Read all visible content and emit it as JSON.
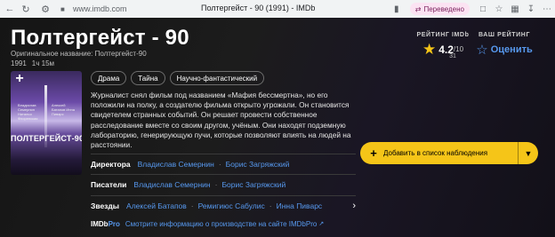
{
  "browser": {
    "url": "www.imdb.com",
    "tab_title": "Полтергейст - 90 (1991) - IMDb",
    "translated_label": "Переведено"
  },
  "movie": {
    "title": "Полтергейст - 90",
    "original_title": "Оригинальное название: Полтергейст-90",
    "year": "1991",
    "runtime": "1ч 15м",
    "genres": [
      "Драма",
      "Тайна",
      "Научно-фантастический"
    ],
    "plot": "Журналист снял фильм под названием «Мафия бессмертна», но его положили на полку, а создателю фильма открыто угрожали. Он становится свидетелем странных событий. Он решает провести собственное расследование вместе со своим другом, учёным. Они находят подземную лабораторию, генерирующую пучи, которые позволяют влиять на людей на расстоянии.",
    "poster_title": "ПОЛТЕРГЕЙСТ-90",
    "poster_names_left": "Владислав Семернин Наталья Флоренская",
    "poster_names_right": "Алексей Батапов Инна Пиварс"
  },
  "rating": {
    "label": "РЕЙТИНГ IMDb",
    "score": "4.2",
    "out_of": "/10",
    "votes": "31"
  },
  "your_rating": {
    "label": "ВАШ РЕЙТИНГ",
    "action": "Оценить"
  },
  "credits": {
    "directors_label": "Директора",
    "directors": [
      "Владислав Семернин",
      "Борис Загряжский"
    ],
    "writers_label": "Писатели",
    "writers": [
      "Владислав Семернин",
      "Борис Загряжский"
    ],
    "stars_label": "Звезды",
    "stars": [
      "Алексей Батапов",
      "Ремигиюс Сабулис",
      "Инна Пиварс"
    ]
  },
  "imdbpro": {
    "logo_main": "IMDb",
    "logo_pro": "Pro",
    "link": "Смотрите информацию о производстве на сайте IMDbPro"
  },
  "watchlist": {
    "label": "Добавить в список наблюдения"
  },
  "colors": {
    "accent_yellow": "#f5c518",
    "link_blue": "#5799ef",
    "background": "#1f1f1f"
  }
}
